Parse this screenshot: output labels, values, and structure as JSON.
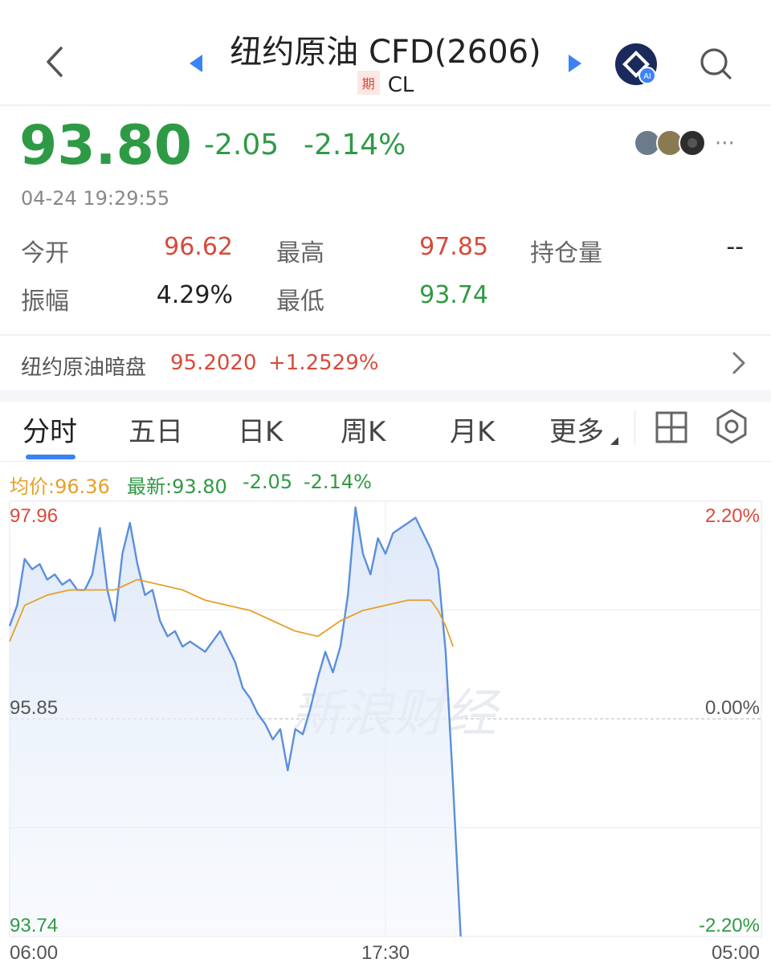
{
  "header": {
    "title": "纽约原油 CFD(2606)",
    "badge": "期",
    "symbol": "CL",
    "ai_badge": "AI"
  },
  "quote": {
    "price": "93.80",
    "change": "-2.05",
    "change_pct": "-2.14%",
    "timestamp": "04-24 19:29:55",
    "more": "···"
  },
  "stats": {
    "open_label": "今开",
    "open": "96.62",
    "high_label": "最高",
    "high": "97.85",
    "oi_label": "持仓量",
    "oi": "--",
    "amp_label": "振幅",
    "amp": "4.29%",
    "low_label": "最低",
    "low": "93.74"
  },
  "night": {
    "label": "纽约原油暗盘",
    "value": "95.2020",
    "pct": "+1.2529%"
  },
  "tabs": [
    "分时",
    "五日",
    "日K",
    "周K",
    "月K",
    "更多"
  ],
  "legend": {
    "avg": "均价:96.36",
    "latest": "最新:93.80",
    "chg": "-2.05",
    "pct": "-2.14%"
  },
  "colors": {
    "up": "#d84a3a",
    "down": "#2f9a45",
    "line": "#5b8fdc",
    "avg": "#e5a02a",
    "accent": "#3b82f6"
  },
  "chart_data": {
    "type": "line",
    "watermark": "新浪财经",
    "y_left_ticks": [
      "97.96",
      "95.85",
      "93.74"
    ],
    "y_right_ticks": [
      "2.20%",
      "0.00%",
      "-2.20%"
    ],
    "x_ticks": [
      "06:00",
      "17:30",
      "05:00"
    ],
    "ylim": [
      93.74,
      97.96
    ],
    "prev_close": 95.85,
    "series": [
      {
        "x": [
          0,
          1,
          2,
          3,
          4,
          5,
          6,
          7,
          8,
          9,
          10,
          11,
          12,
          13,
          14,
          15,
          16,
          17,
          18,
          19,
          20,
          21,
          22,
          23,
          24,
          25,
          26,
          27,
          28,
          29,
          30,
          31,
          32,
          33,
          34,
          35,
          36,
          37,
          38,
          39,
          40,
          41,
          42,
          43,
          44,
          45,
          46,
          47,
          48,
          49,
          50,
          51,
          52,
          53,
          54,
          55,
          56,
          57,
          58,
          59,
          60
        ],
        "values": [
          96.75,
          96.95,
          97.4,
          97.3,
          97.35,
          97.2,
          97.25,
          97.15,
          97.2,
          97.1,
          97.1,
          97.25,
          97.7,
          97.1,
          96.8,
          97.45,
          97.75,
          97.35,
          97.05,
          97.1,
          96.8,
          96.65,
          96.7,
          96.55,
          96.6,
          96.55,
          96.5,
          96.6,
          96.7,
          96.55,
          96.4,
          96.15,
          96.05,
          95.9,
          95.8,
          95.65,
          95.75,
          95.35,
          95.75,
          95.7,
          95.95,
          96.25,
          96.5,
          96.3,
          96.55,
          97.05,
          97.9,
          97.45,
          97.25,
          97.6,
          97.45,
          97.65,
          97.7,
          97.75,
          97.8,
          97.65,
          97.5,
          97.3,
          96.5,
          95.2,
          93.74
        ],
        "x_max": 100
      },
      {
        "x": [
          0,
          2,
          5,
          8,
          11,
          14,
          17,
          20,
          23,
          26,
          29,
          32,
          35,
          38,
          41,
          44,
          47,
          50,
          53,
          56,
          57,
          58,
          59
        ],
        "values": [
          96.6,
          96.95,
          97.05,
          97.1,
          97.1,
          97.1,
          97.2,
          97.15,
          97.1,
          97.0,
          96.95,
          96.9,
          96.8,
          96.7,
          96.65,
          96.8,
          96.9,
          96.95,
          97.0,
          97.0,
          96.9,
          96.75,
          96.55
        ],
        "x_max": 100
      }
    ]
  }
}
